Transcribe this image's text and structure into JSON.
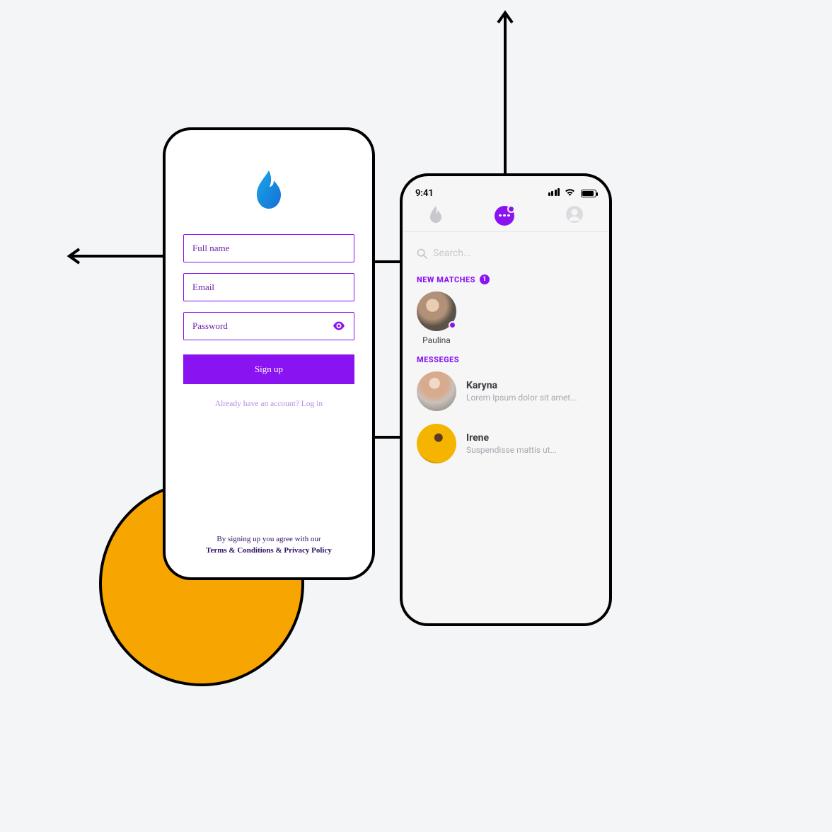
{
  "colors": {
    "accent": "#8a13f2",
    "orange": "#f7a500"
  },
  "signup": {
    "fields": {
      "fullname_placeholder": "Full name",
      "email_placeholder": "Email",
      "password_placeholder": "Password"
    },
    "button_label": "Sign up",
    "already_text": "Already have an account? Log in",
    "footer_line1": "By signing up you agree with our",
    "footer_line2": "Terms & Conditions & Privacy Policy"
  },
  "messages": {
    "status_time": "9:41",
    "search_placeholder": "Search...",
    "new_matches_label": "NEW MATCHES",
    "new_matches_count": "1",
    "matches": [
      {
        "name": "Paulina"
      }
    ],
    "messages_label": "MESSEGES",
    "threads": [
      {
        "name": "Karyna",
        "preview": "Lorem Ipsum dolor sit amet..."
      },
      {
        "name": "Irene",
        "preview": "Suspendisse mattis ut..."
      }
    ]
  }
}
